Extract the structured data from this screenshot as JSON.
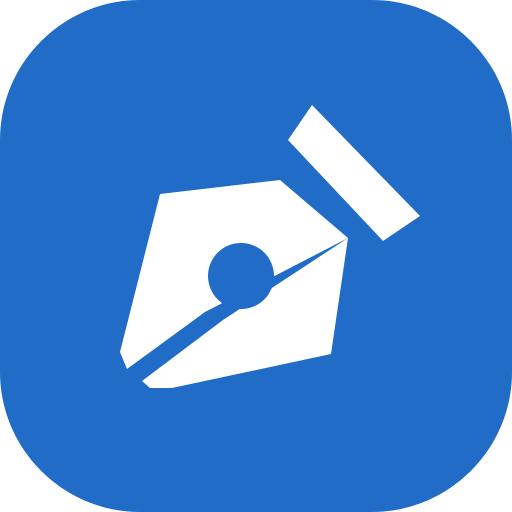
{
  "icon": {
    "name": "pen-nib-icon",
    "shape": "rounded-square",
    "colors": {
      "background": "#206CC6",
      "glyph": "#FFFFFF"
    }
  }
}
